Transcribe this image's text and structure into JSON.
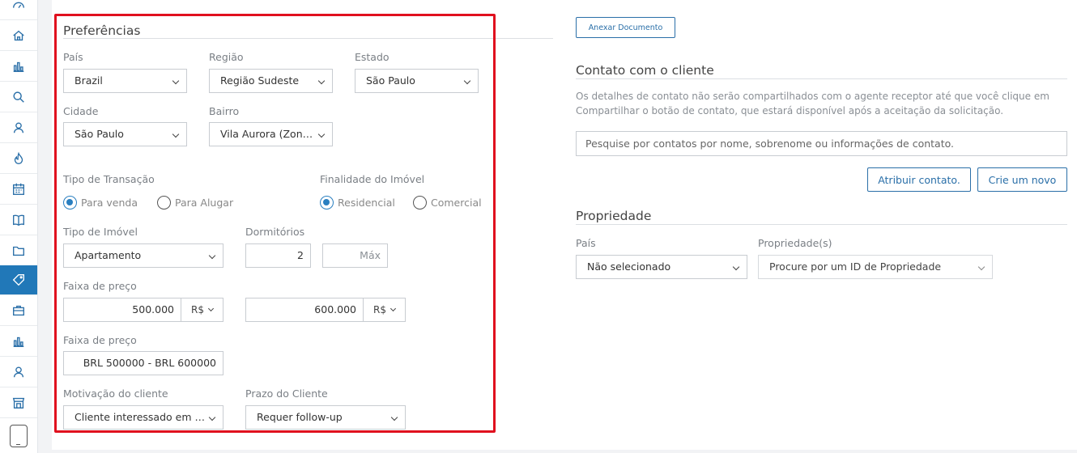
{
  "sidebar": {
    "icons": [
      "speedometer-icon",
      "home-icon",
      "bar-chart-icon",
      "search-icon",
      "person-pin-icon",
      "fire-icon",
      "calendar-icon",
      "book-icon",
      "folder-icon",
      "tag-icon",
      "briefcase-icon",
      "stats-icon",
      "user-icon",
      "store-icon",
      "phone-icon"
    ],
    "active": "tag-icon",
    "accent": "#2178b8"
  },
  "preferences": {
    "title": "Preferências",
    "pais_label": "País",
    "pais_value": "Brazil",
    "regiao_label": "Região",
    "regiao_value": "Região Sudeste",
    "estado_label": "Estado",
    "estado_value": "São Paulo",
    "cidade_label": "Cidade",
    "cidade_value": "São Paulo",
    "bairro_label": "Bairro",
    "bairro_value": "Vila Aurora (Zon…",
    "transacao_label": "Tipo de Transação",
    "transacao_options": [
      "Para venda",
      "Para Alugar"
    ],
    "transacao_selected": "Para venda",
    "finalidade_label": "Finalidade do Imóvel",
    "finalidade_options": [
      "Residencial",
      "Comercial"
    ],
    "finalidade_selected": "Residencial",
    "tipo_imovel_label": "Tipo de Imóvel",
    "tipo_imovel_value": "Apartamento",
    "dormitorios_label": "Dormitórios",
    "dormitorios_min": "2",
    "dormitorios_max_placeholder": "Máx",
    "faixa_label": "Faixa de preço",
    "preco_min": "500.000",
    "preco_max": "600.000",
    "currency": "R$",
    "faixa2_label": "Faixa de preço",
    "faixa2_value": "BRL 500000 - BRL 600000",
    "motivacao_label": "Motivação do cliente",
    "motivacao_value": "Cliente interessado em …",
    "prazo_label": "Prazo do Cliente",
    "prazo_value": "Requer follow-up",
    "highlight_color": "#e0101e"
  },
  "attach_button": "Anexar Documento",
  "contact": {
    "title": "Contato com o cliente",
    "description": "Os detalhes de contato não serão compartilhados com o agente receptor até que você clique em Compartilhar o botão de contato, que estará disponível após a aceitação da solicitação.",
    "search_placeholder": "Pesquise por contatos por nome, sobrenome ou informações de contato.",
    "assign_button": "Atribuir contato.",
    "create_button": "Crie um novo"
  },
  "property": {
    "title": "Propriedade",
    "pais_label": "País",
    "pais_value": "Não selecionado",
    "prop_label": "Propriedade(s)",
    "prop_value": "Procure por um ID de Propriedade"
  }
}
